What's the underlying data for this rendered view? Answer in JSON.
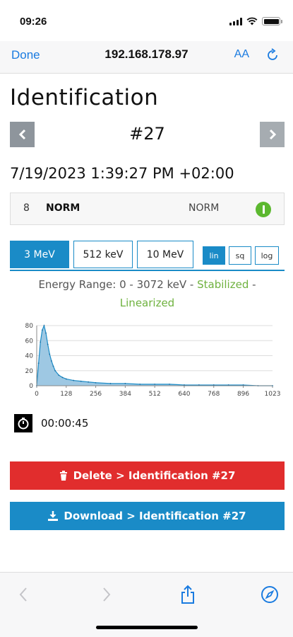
{
  "status_bar": {
    "time": "09:26"
  },
  "browser": {
    "done_label": "Done",
    "url": "192.168.178.97",
    "text_size_label": "AA"
  },
  "page": {
    "title": "Identification",
    "pager_number": "#27",
    "datetime": "7/19/2023 1:39:27 PM +02:00",
    "result_row": {
      "index": "8",
      "name": "NORM",
      "category": "NORM"
    },
    "energy_tabs": [
      {
        "label": "3 MeV",
        "active": true
      },
      {
        "label": "512 keV",
        "active": false
      },
      {
        "label": "10 MeV",
        "active": false
      }
    ],
    "scale_buttons": [
      {
        "label": "lin",
        "active": true
      },
      {
        "label": "sq",
        "active": false
      },
      {
        "label": "log",
        "active": false
      }
    ],
    "energy_range_text": "Energy Range: 0 - 3072 keV - ",
    "stabilized_text": "Stabilized",
    "range_separator": " -",
    "linearized_text": "Linearized",
    "duration": "00:00:45",
    "delete_label": "Delete > Identification #27",
    "download_label": "Download > Identification #27"
  },
  "colors": {
    "accent": "#1a8bc7",
    "delete": "#e12d2d",
    "status_ok": "#5cb82f",
    "link": "#1a7be0"
  },
  "icons": [
    "cellular-signal-icon",
    "wifi-icon",
    "battery-icon",
    "reload-icon",
    "chevron-left-icon",
    "chevron-right-icon",
    "status-ok-icon",
    "stopwatch-icon",
    "trash-icon",
    "download-icon",
    "back-icon",
    "forward-icon",
    "share-icon",
    "compass-icon"
  ],
  "chart_data": {
    "type": "area",
    "xlim": [
      0,
      1023
    ],
    "ylim": [
      0,
      80
    ],
    "xticks": [
      0,
      128,
      256,
      384,
      512,
      640,
      768,
      896,
      1023
    ],
    "yticks": [
      0,
      20,
      40,
      60,
      80
    ],
    "grid": true,
    "x": [
      0,
      8,
      16,
      24,
      32,
      40,
      48,
      56,
      64,
      72,
      80,
      96,
      112,
      128,
      160,
      192,
      224,
      256,
      320,
      384,
      448,
      512,
      576,
      640,
      704,
      768,
      832,
      896,
      960,
      1023
    ],
    "values": [
      0,
      30,
      58,
      74,
      80,
      70,
      55,
      42,
      33,
      26,
      20,
      14,
      11,
      9,
      7,
      6,
      5,
      4,
      3,
      3,
      2,
      2,
      2,
      1,
      1,
      1,
      1,
      1,
      0,
      0
    ]
  }
}
